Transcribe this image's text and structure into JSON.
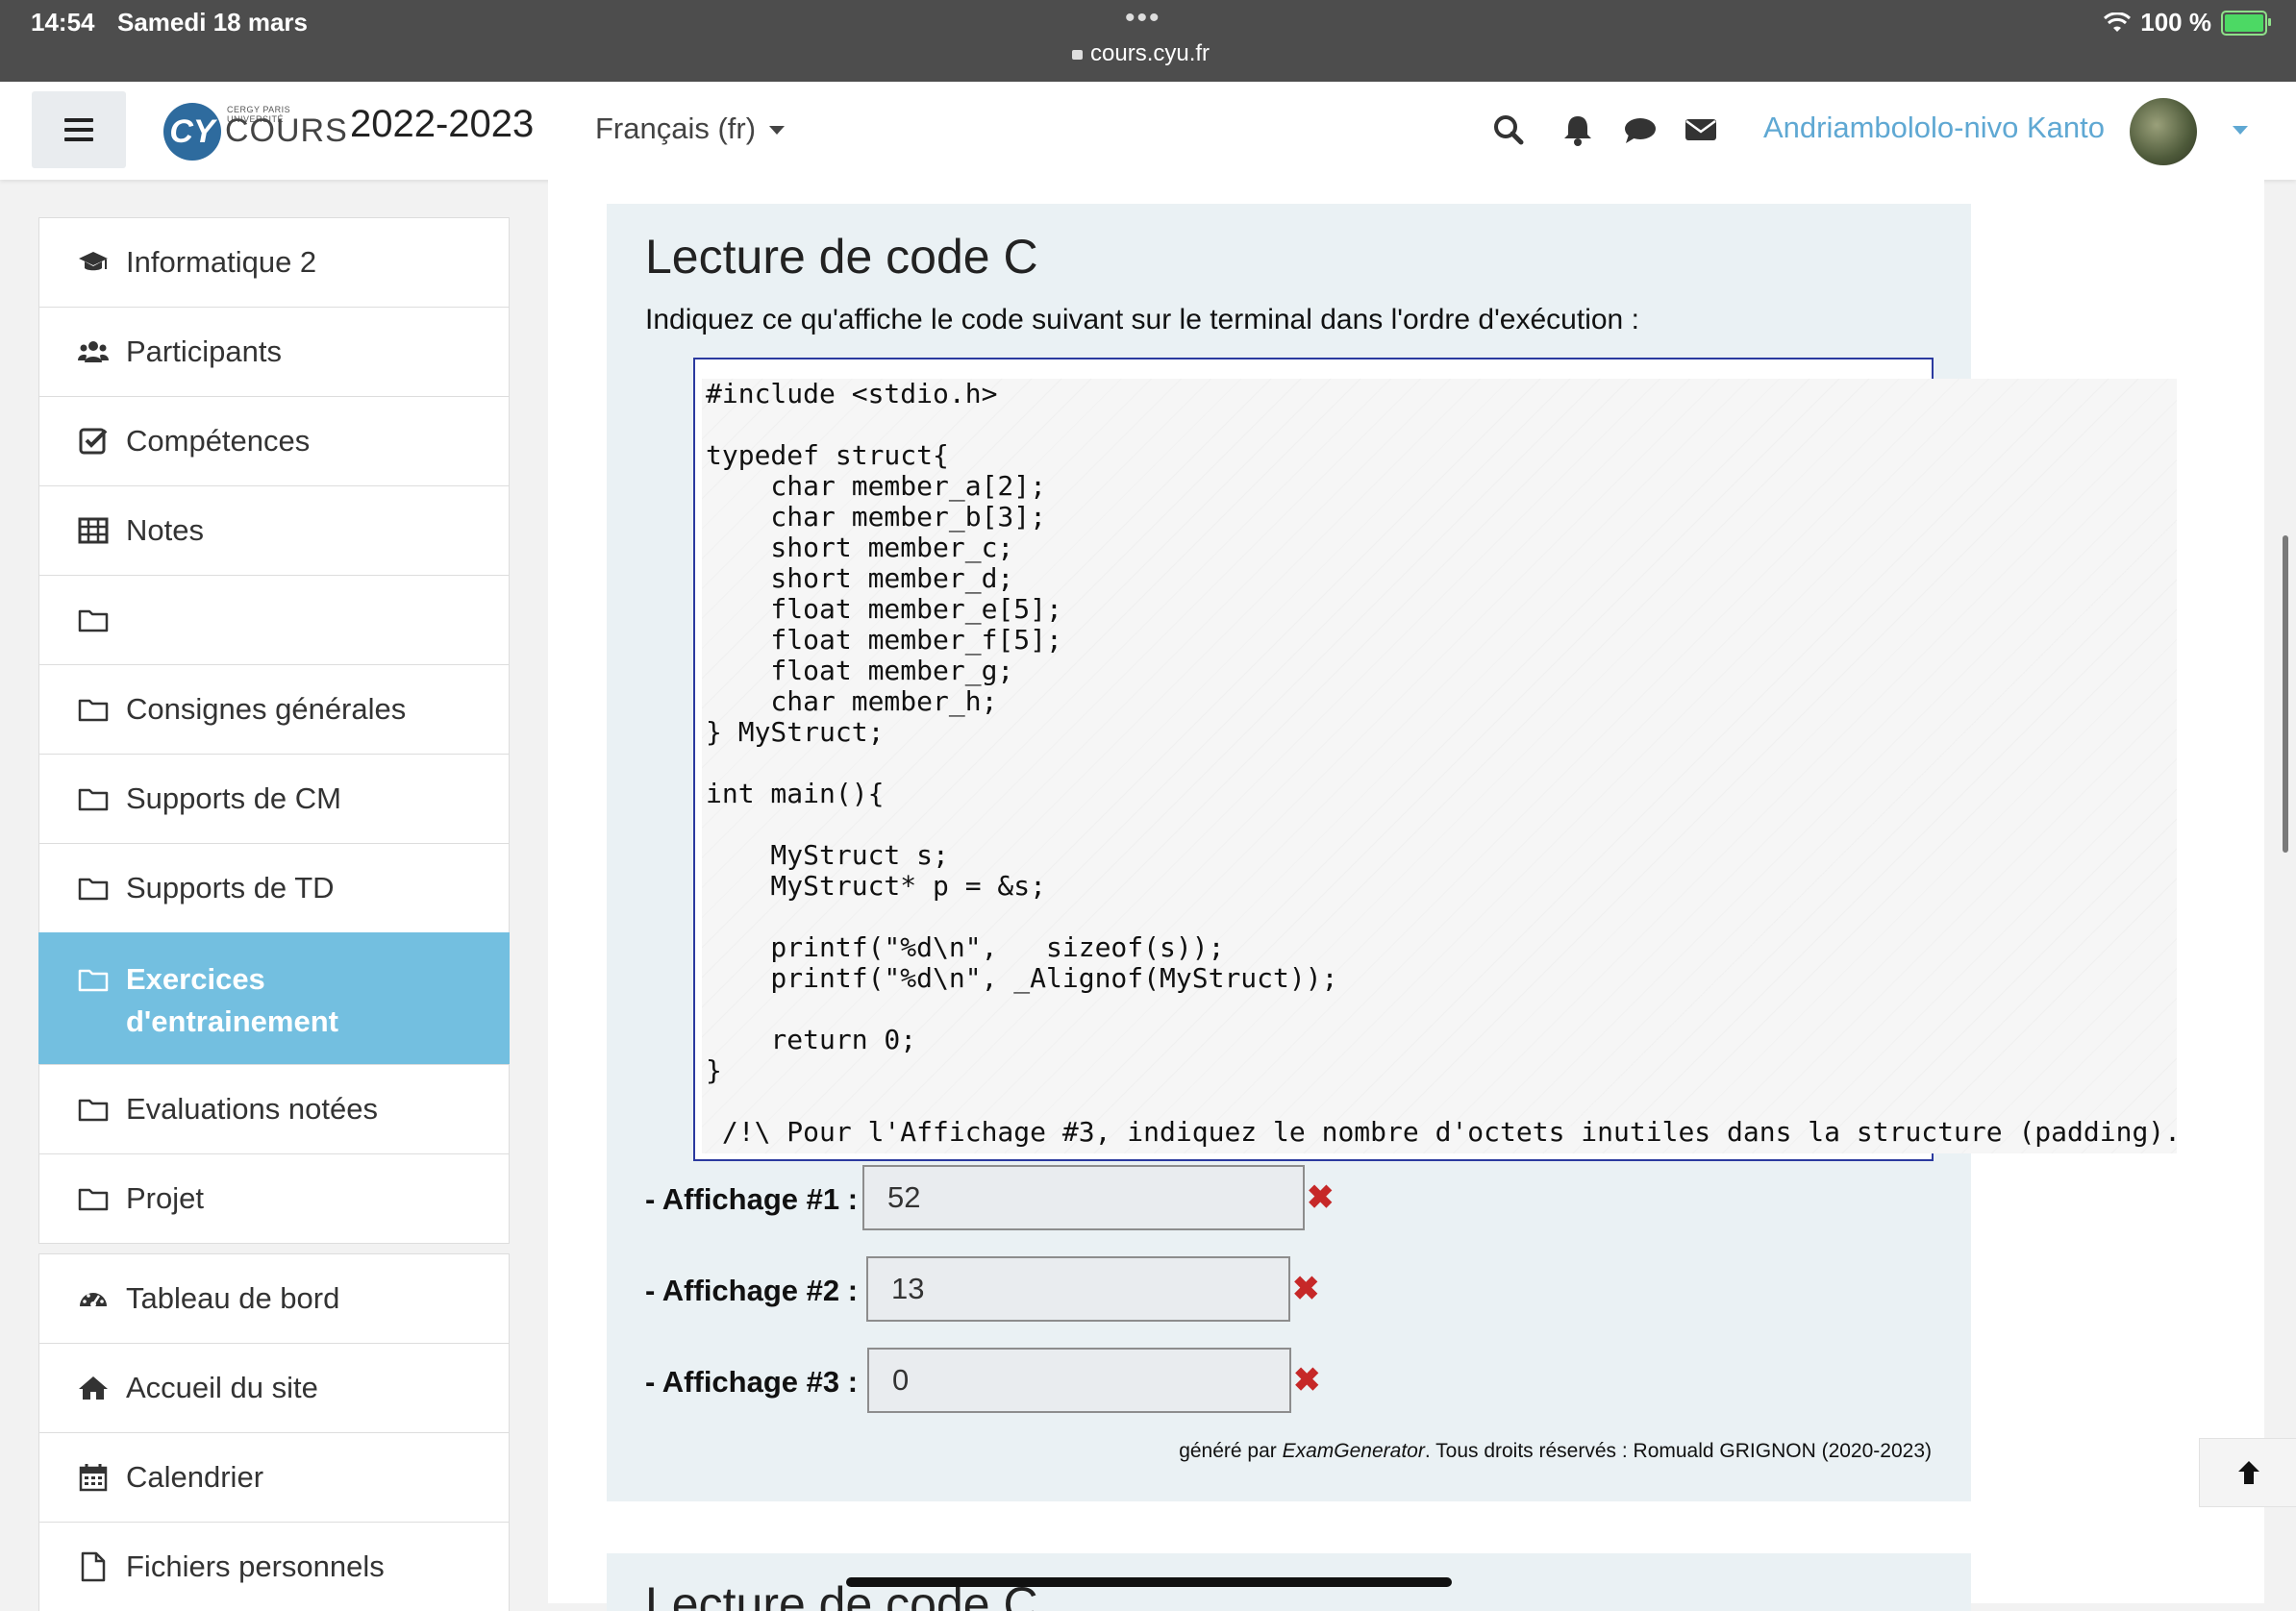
{
  "status_bar": {
    "time": "14:54",
    "date": "Samedi 18 mars",
    "url": "cours.cyu.fr",
    "battery": "100 %",
    "dots": "•••"
  },
  "navbar": {
    "logo_small": "CERGY PARIS UNIVERSITÉ",
    "logo_cy": "CY",
    "logo_text": "COURS",
    "year": "2022-2023",
    "language": "Français (fr)",
    "user_name": "Andriambololo-nivo Kanto",
    "icons": [
      "search-icon",
      "bell-icon",
      "comment-icon",
      "envelope-icon"
    ]
  },
  "sidebar": {
    "items": [
      {
        "label": "Informatique 2",
        "icon": "graduation-cap-icon"
      },
      {
        "label": "Participants",
        "icon": "users-icon"
      },
      {
        "label": "Compétences",
        "icon": "check-square-icon"
      },
      {
        "label": "Notes",
        "icon": "table-icon"
      },
      {
        "label": "",
        "icon": "folder-icon"
      },
      {
        "label": "Consignes générales",
        "icon": "folder-icon"
      },
      {
        "label": "Supports de CM",
        "icon": "folder-icon"
      },
      {
        "label": "Supports de TD",
        "icon": "folder-icon"
      },
      {
        "label": "Exercices d'entrainement",
        "icon": "folder-icon",
        "active": true
      },
      {
        "label": "Evaluations notées",
        "icon": "folder-icon"
      },
      {
        "label": "Projet",
        "icon": "folder-icon"
      },
      {
        "label": "Tableau de bord",
        "icon": "dashboard-icon"
      },
      {
        "label": "Accueil du site",
        "icon": "home-icon"
      },
      {
        "label": "Calendrier",
        "icon": "calendar-icon"
      },
      {
        "label": "Fichiers personnels",
        "icon": "file-icon"
      }
    ],
    "active_color": "#73bfe0"
  },
  "question": {
    "title": "Lecture de code C",
    "instructions": "Indiquez ce qu'affiche le code suivant sur le terminal dans l'ordre d'exécution :",
    "code_lines": [
      "#include <stdio.h>",
      "",
      "typedef struct{",
      "    char member_a[2];",
      "    char member_b[3];",
      "    short member_c;",
      "    short member_d;",
      "    float member_e[5];",
      "    float member_f[5];",
      "    float member_g;",
      "    char member_h;",
      "} MyStruct;",
      "",
      "int main(){",
      "",
      "    MyStruct s;",
      "    MyStruct* p = &s;",
      "",
      "    printf(\"%d\\n\",   sizeof(s));",
      "    printf(\"%d\\n\", _Alignof(MyStruct));",
      "",
      "    return 0;",
      "}",
      "",
      " /!\\ Pour l'Affichage #3, indiquez le nombre d'octets inutiles dans la structure (padding)."
    ],
    "answers": [
      {
        "label": "- Affichage #1 :",
        "value": "52",
        "status": "incorrect"
      },
      {
        "label": "- Affichage #2 :",
        "value": "13",
        "status": "incorrect"
      },
      {
        "label": "- Affichage #3 :",
        "value": "0",
        "status": "incorrect"
      }
    ],
    "footer_prefix": "généré par ",
    "footer_tool": "ExamGenerator",
    "footer_suffix": ". Tous droits réservés : Romuald GRIGNON (2020-2023)",
    "wrong_mark": "✖"
  },
  "next_question": {
    "title": "Lecture de code C"
  }
}
